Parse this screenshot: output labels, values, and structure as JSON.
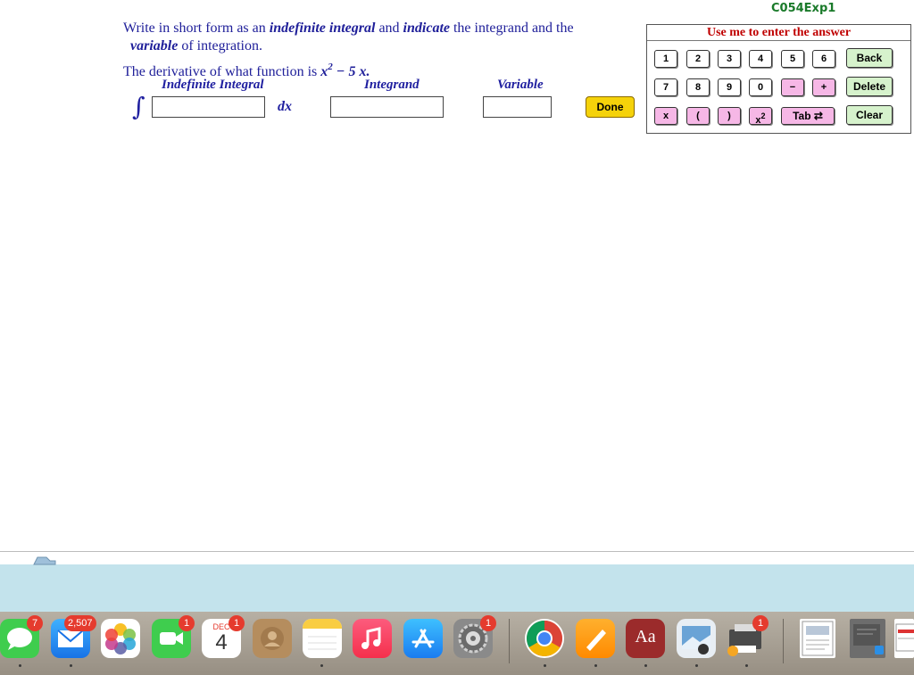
{
  "header": {
    "code": "C054Exp1"
  },
  "question": {
    "line1_a": "Write in short form as an ",
    "line1_b": "indefinite integral",
    "line1_c": " and ",
    "line1_d": "indicate",
    "line1_e": " the integrand and the",
    "line2_a": "variable",
    "line2_b": " of integration.",
    "line3_a": "The derivative of what function is ",
    "line3_x": "x",
    "line3_exp": "2",
    "line3_rest": " − 5 x."
  },
  "answer": {
    "header_integral": "Indefinite Integral",
    "header_integrand": "Integrand",
    "header_variable": "Variable",
    "integral_sign": "∫",
    "dx": "dx",
    "done_label": "Done"
  },
  "keypad": {
    "title": "Use me to enter the answer",
    "digits_row1": [
      "1",
      "2",
      "3",
      "4",
      "5",
      "6"
    ],
    "digits_row2": [
      "7",
      "8",
      "9",
      "0"
    ],
    "minus": "−",
    "plus": "+",
    "x": "x",
    "lparen": "(",
    "rparen": ")",
    "xsq_base": "x",
    "xsq_exp": "2",
    "tab": "Tab ⇄",
    "back": "Back",
    "delete": "Delete",
    "clear": "Clear"
  },
  "dock": {
    "badges": {
      "messages": "7",
      "mail": "2,507",
      "facetime": "1",
      "calendar": "1",
      "settings": "1",
      "printer": "1"
    },
    "calendar_month": "DEC",
    "calendar_day": "4",
    "dictionary_label": "Aa"
  }
}
